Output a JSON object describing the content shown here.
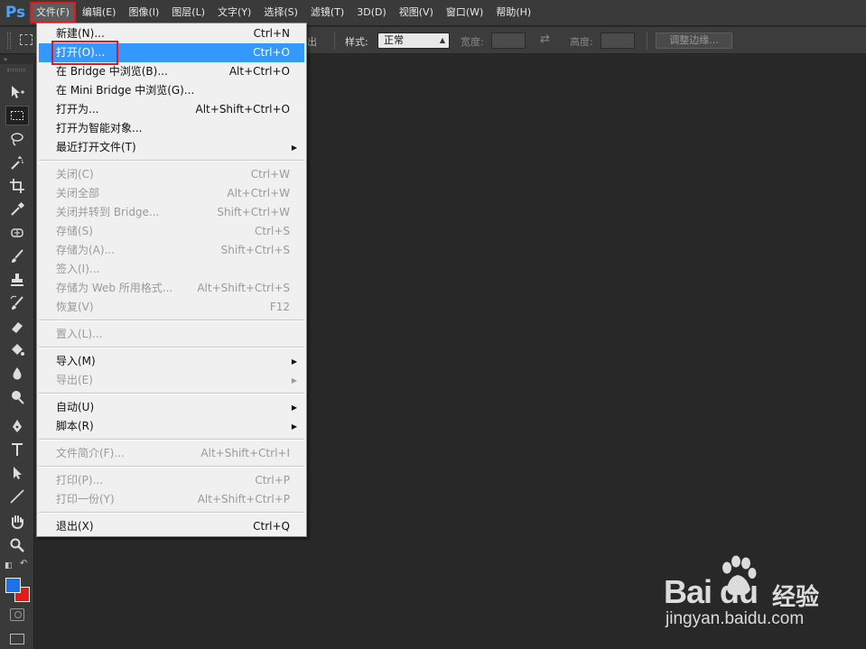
{
  "app": {
    "logo": "Ps",
    "accent_color": "#4ba3ff"
  },
  "menubar": {
    "items": [
      {
        "label": "文件(F)",
        "active": true
      },
      {
        "label": "编辑(E)"
      },
      {
        "label": "图像(I)"
      },
      {
        "label": "图层(L)"
      },
      {
        "label": "文字(Y)"
      },
      {
        "label": "选择(S)"
      },
      {
        "label": "滤镜(T)"
      },
      {
        "label": "3D(D)"
      },
      {
        "label": "视图(V)"
      },
      {
        "label": "窗口(W)"
      },
      {
        "label": "帮助(H)"
      }
    ]
  },
  "options": {
    "partial_label": "出",
    "style_label": "样式:",
    "style_value": "正常",
    "width_label": "宽度:",
    "height_label": "高度:",
    "refine_edge_label": "调整边缘..."
  },
  "file_menu": {
    "items": [
      {
        "label": "新建(N)...",
        "shortcut": "Ctrl+N"
      },
      {
        "label": "打开(O)...",
        "shortcut": "Ctrl+O",
        "highlighted": true
      },
      {
        "label": "在 Bridge 中浏览(B)...",
        "shortcut": "Alt+Ctrl+O"
      },
      {
        "label": "在 Mini Bridge 中浏览(G)...",
        "shortcut": ""
      },
      {
        "label": "打开为...",
        "shortcut": "Alt+Shift+Ctrl+O"
      },
      {
        "label": "打开为智能对象...",
        "shortcut": ""
      },
      {
        "label": "最近打开文件(T)",
        "shortcut": "",
        "submenu": true
      },
      {
        "label": "关闭(C)",
        "shortcut": "Ctrl+W",
        "disabled": true
      },
      {
        "label": "关闭全部",
        "shortcut": "Alt+Ctrl+W",
        "disabled": true
      },
      {
        "label": "关闭并转到 Bridge...",
        "shortcut": "Shift+Ctrl+W",
        "disabled": true
      },
      {
        "label": "存储(S)",
        "shortcut": "Ctrl+S",
        "disabled": true
      },
      {
        "label": "存储为(A)...",
        "shortcut": "Shift+Ctrl+S",
        "disabled": true
      },
      {
        "label": "签入(I)...",
        "shortcut": "",
        "disabled": true
      },
      {
        "label": "存储为 Web 所用格式...",
        "shortcut": "Alt+Shift+Ctrl+S",
        "disabled": true
      },
      {
        "label": "恢复(V)",
        "shortcut": "F12",
        "disabled": true
      },
      {
        "label": "置入(L)...",
        "shortcut": "",
        "disabled": true
      },
      {
        "label": "导入(M)",
        "shortcut": "",
        "submenu": true
      },
      {
        "label": "导出(E)",
        "shortcut": "",
        "submenu": true,
        "disabled": true
      },
      {
        "label": "自动(U)",
        "shortcut": "",
        "submenu": true
      },
      {
        "label": "脚本(R)",
        "shortcut": "",
        "submenu": true
      },
      {
        "label": "文件简介(F)...",
        "shortcut": "Alt+Shift+Ctrl+I",
        "disabled": true
      },
      {
        "label": "打印(P)...",
        "shortcut": "Ctrl+P",
        "disabled": true
      },
      {
        "label": "打印一份(Y)",
        "shortcut": "Alt+Shift+Ctrl+P",
        "disabled": true
      },
      {
        "label": "退出(X)",
        "shortcut": "Ctrl+Q"
      }
    ]
  },
  "colors": {
    "foreground": "#1a73e8",
    "background": "#e21b1b",
    "highlight": "#3399ff",
    "annotation_box": "#e8161c"
  },
  "watermark": {
    "logo_text": "Bai du",
    "product": "经验",
    "url": "jingyan.baidu.com"
  }
}
